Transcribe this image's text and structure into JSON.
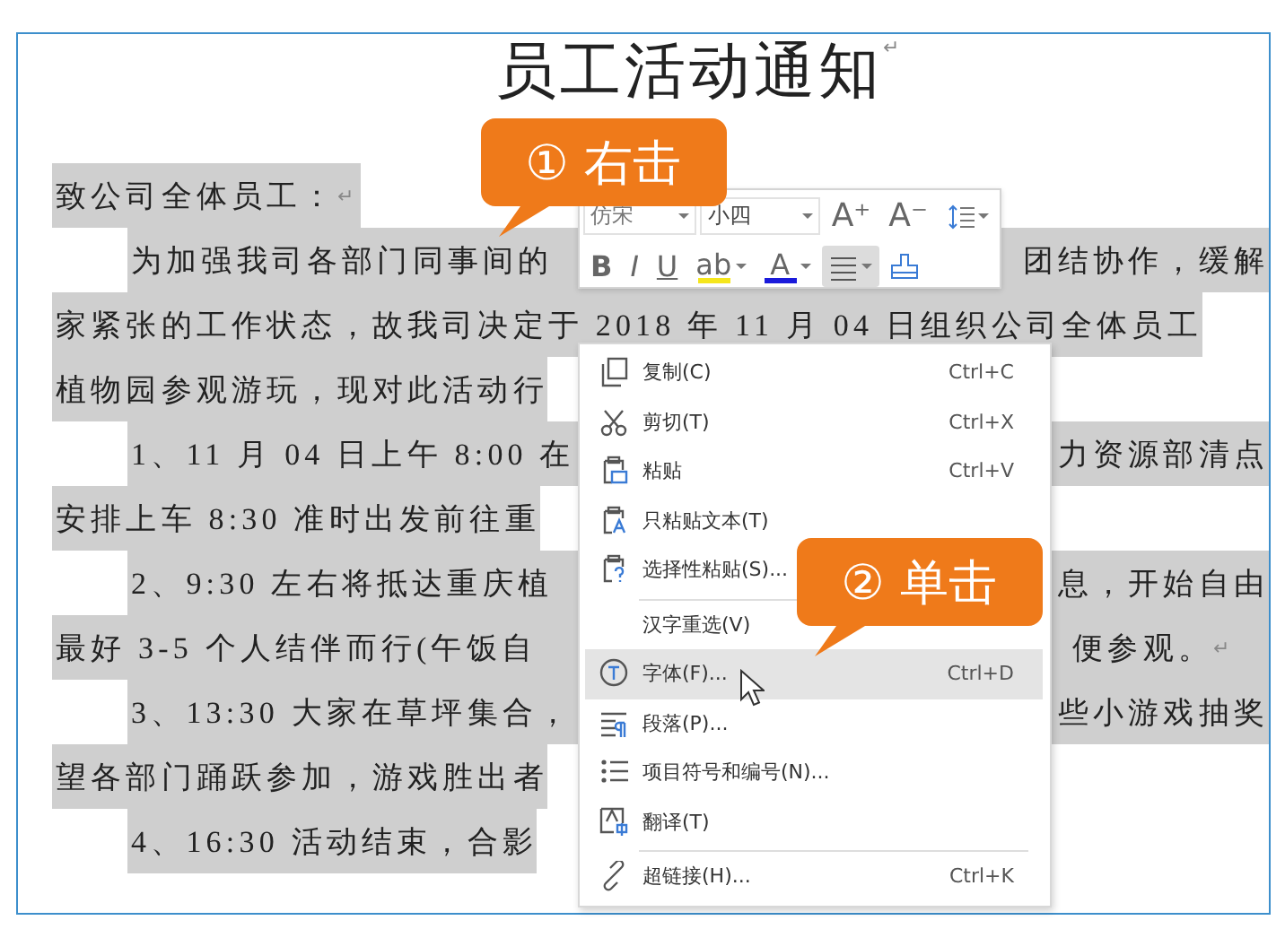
{
  "document": {
    "title": "员工活动通知",
    "title_mark": "↵",
    "lines": [
      {
        "left": "致公司全体员工：",
        "mark": "↵",
        "indent": false,
        "selected": true
      },
      {
        "left": "为加强我司各部门同事间的",
        "right": "团结协作，缓解",
        "indent": true,
        "selected": true
      },
      {
        "left": "家紧张的工作状态，故我司决定于 2018 年 11 月 04 日组织公司全体员工",
        "indent": false,
        "selected": true
      },
      {
        "left": "植物园参观游玩，现对此活动行",
        "indent": false,
        "selected": true
      },
      {
        "left": "1、11 月 04 日上午 8:00 在",
        "right": "力资源部清点",
        "indent": true,
        "selected": true
      },
      {
        "left": "安排上车 8:30 准时出发前往重",
        "indent": false,
        "selected": true
      },
      {
        "left": "2、9:30 左右将抵达重庆植",
        "right": "息，开始自由",
        "indent": true,
        "selected": true
      },
      {
        "left": "最好 3-5 个人结伴而行(午饭自",
        "right": "便参观。",
        "mark": "↵",
        "indent": false,
        "selected": true
      },
      {
        "left": "3、13:30 大家在草坪集合，",
        "right": "些小游戏抽奖",
        "indent": true,
        "selected": true
      },
      {
        "left": "望各部门踊跃参加，游戏胜出者",
        "indent": false,
        "selected": true
      },
      {
        "left": "4、16:30 活动结束，合影",
        "indent": true,
        "selected": true
      }
    ]
  },
  "toolbar": {
    "font": "仿宋",
    "size": "小四",
    "row_1": [
      {
        "kind": "text",
        "label": "A⁺",
        "dropdown": false,
        "selected": false
      },
      {
        "kind": "text",
        "label": "A⁻",
        "dropdown": false,
        "selected": false
      },
      {
        "kind": "line-spacing",
        "dropdown": true,
        "selected": false
      }
    ],
    "row_2": [
      {
        "kind": "bold",
        "label": "B",
        "dropdown": false,
        "selected": false
      },
      {
        "kind": "italic",
        "label": "I",
        "dropdown": false,
        "selected": false
      },
      {
        "kind": "underline",
        "label": "U",
        "dropdown": false,
        "selected": false
      },
      {
        "kind": "color",
        "label": "ab",
        "color": "#f5e61c",
        "dropdown": true,
        "selected": false
      },
      {
        "kind": "color",
        "label": "A",
        "color": "#1a1adb",
        "dropdown": true,
        "selected": false
      },
      {
        "kind": "align",
        "dropdown": true,
        "selected": true
      },
      {
        "kind": "painter",
        "dropdown": false,
        "selected": false
      }
    ]
  },
  "context_menu": [
    {
      "label": "复制(C)",
      "shortcut": "Ctrl+C",
      "selected": false,
      "divider_before": false
    },
    {
      "label": "剪切(T)",
      "shortcut": "Ctrl+X",
      "selected": false,
      "divider_before": false
    },
    {
      "label": "粘贴",
      "shortcut": "Ctrl+V",
      "selected": false,
      "divider_before": false
    },
    {
      "label": "只粘贴文本(T)",
      "selected": false,
      "divider_before": false
    },
    {
      "label": "选择性粘贴(S)...",
      "selected": false,
      "divider_before": false
    },
    {
      "label": "汉字重选(V)",
      "selected": false,
      "divider_before": true
    },
    {
      "label": "字体(F)...",
      "shortcut": "Ctrl+D",
      "selected": true,
      "divider_before": false
    },
    {
      "label": "段落(P)...",
      "selected": false,
      "divider_before": false
    },
    {
      "label": "项目符号和编号(N)...",
      "selected": false,
      "divider_before": false
    },
    {
      "label": "翻译(T)",
      "selected": false,
      "divider_before": false
    },
    {
      "label": "超链接(H)...",
      "shortcut": "Ctrl+K",
      "selected": false,
      "divider_before": true
    }
  ],
  "callouts": [
    {
      "text": "① 右击"
    },
    {
      "text": "② 单击"
    }
  ]
}
